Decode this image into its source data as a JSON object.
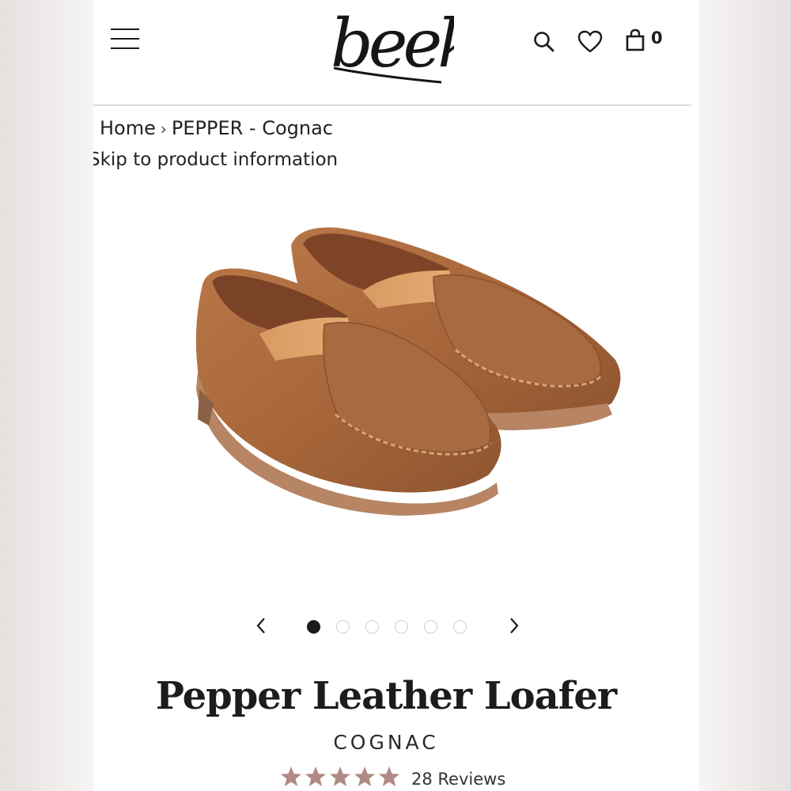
{
  "header": {
    "logo_text": "beek..",
    "cart_count": "0"
  },
  "breadcrumb": {
    "home": "Home",
    "separator": "›",
    "current": "PEPPER - Cognac"
  },
  "skip_link": "Skip to product information",
  "gallery": {
    "slide_count": 6,
    "active_slide": 1
  },
  "product": {
    "title": "Pepper Leather Loafer",
    "color": "COGNAC",
    "rating": 5,
    "reviews_label": "28 Reviews"
  },
  "colors": {
    "star": "#b08a84",
    "leather": "#a86a3e",
    "text": "#1c1c1c"
  },
  "icons": [
    "hamburger-menu-icon",
    "search-icon",
    "heart-icon",
    "shopping-bag-icon",
    "chevron-left-icon",
    "chevron-right-icon",
    "star-icon"
  ]
}
